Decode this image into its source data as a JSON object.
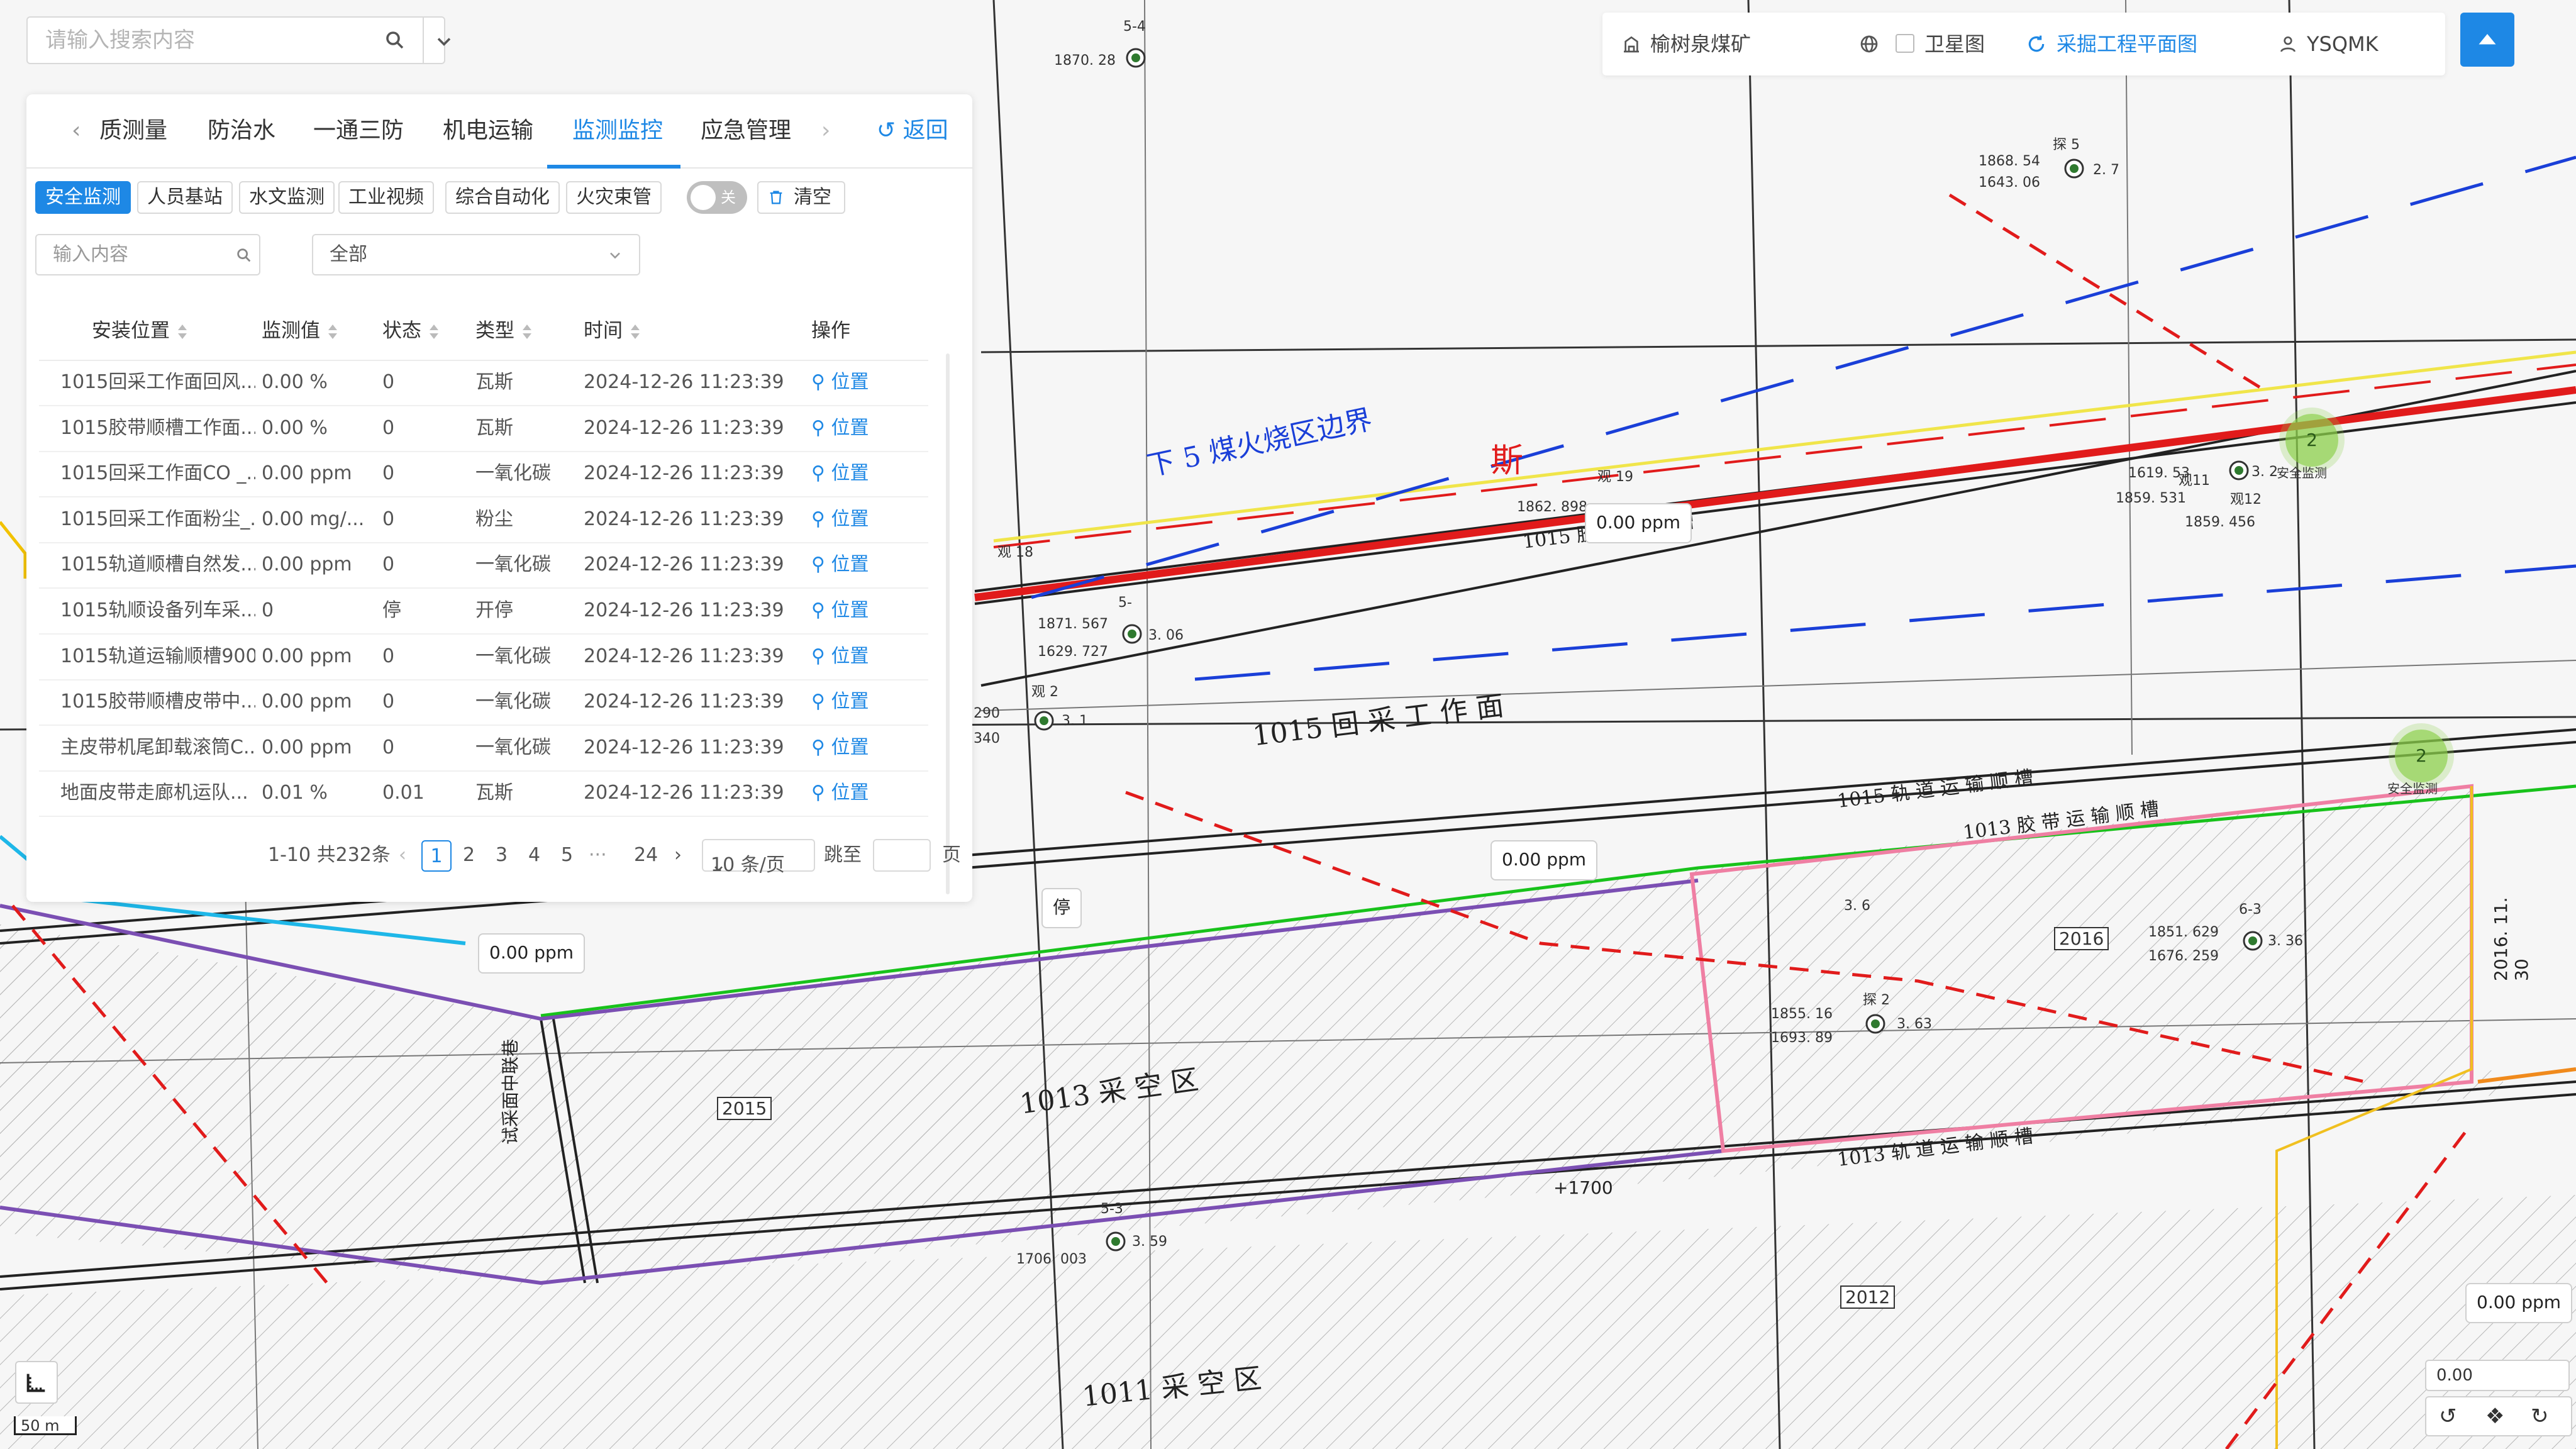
{
  "search": {
    "placeholder": "请输入搜索内容"
  },
  "toolbar": {
    "mine": "榆树泉煤矿",
    "satellite": "卫星图",
    "plan": "采掘工程平面图",
    "user": "YSQMK"
  },
  "panel": {
    "tabs": [
      "质测量",
      "防治水",
      "一通三防",
      "机电运输",
      "监测监控",
      "应急管理"
    ],
    "active_tab": "监测监控",
    "back": "返回",
    "chips": [
      "安全监测",
      "人员基站",
      "水文监测",
      "工业视频",
      "综合自动化",
      "火灾束管"
    ],
    "toggle_label": "关",
    "clear": "清空",
    "filter_placeholder": "输入内容",
    "type_select": "全部",
    "columns": [
      "安装位置",
      "监测值",
      "状态",
      "类型",
      "时间",
      "操作"
    ],
    "rows": [
      {
        "loc": "1015回采工作面回风...",
        "val": "0.00 %",
        "state": "0",
        "type": "瓦斯",
        "time": "2024-12-26 11:23:39",
        "op": "位置"
      },
      {
        "loc": "1015胶带顺槽工作面...",
        "val": "0.00 %",
        "state": "0",
        "type": "瓦斯",
        "time": "2024-12-26 11:23:39",
        "op": "位置"
      },
      {
        "loc": "1015回采工作面CO _...",
        "val": "0.00 ppm",
        "state": "0",
        "type": "一氧化碳",
        "time": "2024-12-26 11:23:39",
        "op": "位置"
      },
      {
        "loc": "1015回采工作面粉尘_...",
        "val": "0.00 mg/...",
        "state": "0",
        "type": "粉尘",
        "time": "2024-12-26 11:23:39",
        "op": "位置"
      },
      {
        "loc": "1015轨道顺槽自然发...",
        "val": "0.00 ppm",
        "state": "0",
        "type": "一氧化碳",
        "time": "2024-12-26 11:23:39",
        "op": "位置"
      },
      {
        "loc": "1015轨顺设备列车采...",
        "val": "0",
        "state": "停",
        "type": "开停",
        "time": "2024-12-26 11:23:39",
        "op": "位置"
      },
      {
        "loc": "1015轨道运输顺槽900...",
        "val": "0.00 ppm",
        "state": "0",
        "type": "一氧化碳",
        "time": "2024-12-26 11:23:39",
        "op": "位置"
      },
      {
        "loc": "1015胶带顺槽皮带中...",
        "val": "0.00 ppm",
        "state": "0",
        "type": "一氧化碳",
        "time": "2024-12-26 11:23:39",
        "op": "位置"
      },
      {
        "loc": "主皮带机尾卸载滚筒C...",
        "val": "0.00 ppm",
        "state": "0",
        "type": "一氧化碳",
        "time": "2024-12-26 11:23:39",
        "op": "位置"
      },
      {
        "loc": "地面皮带走廊机运队...",
        "val": "0.01 %",
        "state": "0.01",
        "type": "瓦斯",
        "time": "2024-12-26 11:23:39",
        "op": "位置"
      }
    ],
    "pager": {
      "summary": "1-10 共232条",
      "pages": [
        "1",
        "2",
        "3",
        "4",
        "5",
        "···",
        "24"
      ],
      "page_size": "10 条/页",
      "jump_label": "跳至",
      "page_unit": "页"
    }
  },
  "map": {
    "fire_boundary": "下 5 煤火烧区边界",
    "gas_char": "斯",
    "face_label": "1015 回 采 工 作 面",
    "road_1015_track": "1015 轨 道 运 输 顺 槽",
    "road_1013_belt": "1013 胶 带 运 输 顺 槽",
    "road_1015_belt": "1015 胶 带 输 顺 槽",
    "goaf_1013": "1013 采 空 区",
    "goaf_1011": "1011 采 空 区",
    "road_1013_track": "1013 轨 道 运 输 顺 槽",
    "contact_road": "试采面中联巷",
    "box_2015": "2015",
    "box_2016": "2016",
    "box_2012": "2012",
    "elev_1700": "+1700",
    "date_text": "2016. 11. 30",
    "ppm_values": [
      "0.00 ppm",
      "0.00 ppm",
      "0.00 ppm",
      "0.00 ppm"
    ],
    "stop_label": "停",
    "cluster_count": "2",
    "cluster_label": "安全监测",
    "station_texts": {
      "s5_4": "5-4",
      "v1870": "1870. 28",
      "tan5": "探 5",
      "v1868": "1868. 54",
      "v1643": "1643. 06",
      "v27": "2. 7",
      "guan19": "观 19",
      "v1862": "1862. 898",
      "guan18": "观 18",
      "v1871": "1871. 567",
      "v1629": "1629. 727",
      "v306": "3. 06",
      "s5": "5-",
      "guan2": "观 2",
      "v31": "3. 1",
      "v1859": "1859. 531",
      "v1619": "1619. 53",
      "v1859b": "1859. 456",
      "guan11": "观11",
      "guan12": "观12",
      "v32": "3. 2",
      "v36": "3. 6",
      "s63": "6-3",
      "v1851": "1851. 629",
      "v1676": "1676. 259",
      "v336": "3. 36",
      "tan2": "探 2",
      "v1855": "1855. 16",
      "v1693": "1693. 89",
      "v363": "3. 63",
      "s53": "5-3",
      "v1706": "1706. 003",
      "v359": "3. 59",
      "v290": "290",
      "v340": "340"
    },
    "scale": "50 m",
    "coord_readout": "0.00"
  },
  "colors": {
    "accent": "#1e88e5",
    "road_red": "#e11b1b",
    "fire_blue": "#1a3fd8",
    "pink": "#ef7fa3",
    "purple": "#7b4fb3",
    "green": "#18c21b",
    "orange": "#f08a1c",
    "cyan": "#1eb7e8"
  }
}
